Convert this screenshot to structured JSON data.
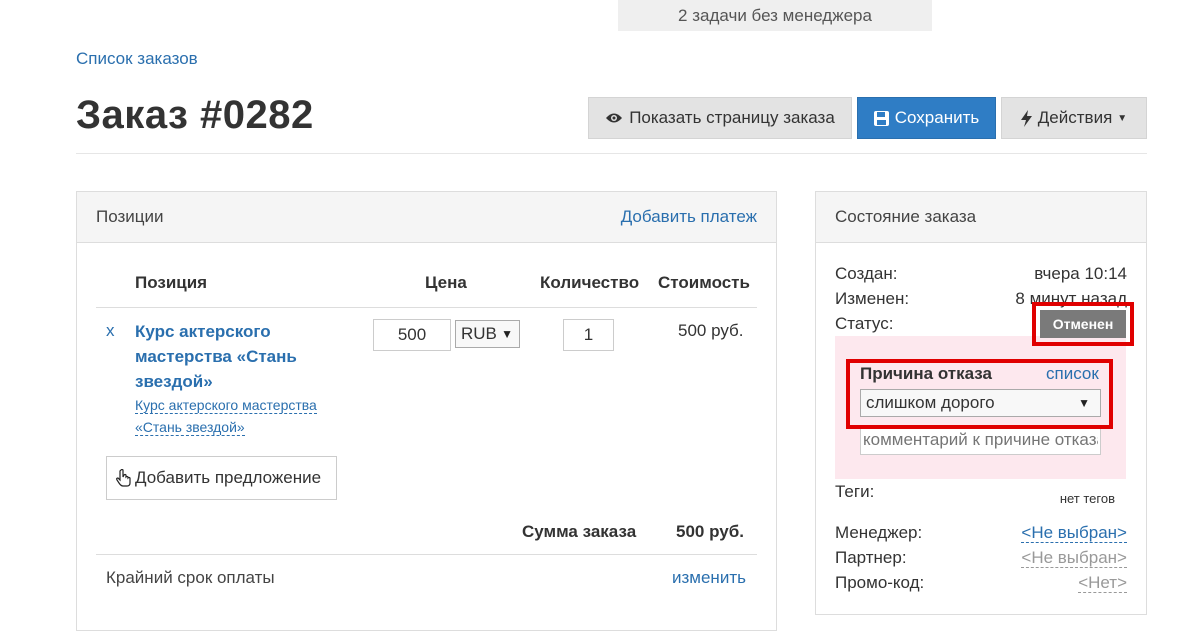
{
  "banner": {
    "text": "2 задачи без менеджера"
  },
  "breadcrumb": {
    "orders_list": "Список заказов"
  },
  "page": {
    "title": "Заказ #0282"
  },
  "toolbar": {
    "show_order_page": "Показать страницу заказа",
    "save": "Сохранить",
    "actions": "Действия"
  },
  "items_panel": {
    "title": "Позиции",
    "add_payment": "Добавить платеж",
    "columns": {
      "position": "Позиция",
      "price": "Цена",
      "quantity": "Количество",
      "cost": "Стоимость"
    },
    "item": {
      "remove": "x",
      "name_line1": "Курс актерского",
      "name_line2": "мастерства «Стань",
      "name_line3": "звездой»",
      "sub_line1": "Курс актерского мастерства",
      "sub_line2": "«Стань звездой»",
      "price": "500",
      "currency": "RUB",
      "quantity": "1",
      "cost": "500 руб."
    },
    "add_offer": "Добавить предложение",
    "total_label": "Сумма заказа",
    "total_value": "500 руб.",
    "deadline_label": "Крайний срок оплаты",
    "deadline_change": "изменить"
  },
  "status_panel": {
    "title": "Состояние заказа",
    "created_label": "Создан:",
    "created_value": "вчера 10:14",
    "modified_label": "Изменен:",
    "modified_value": "8 минут назад",
    "status_label": "Статус:",
    "status_value": "Отменен",
    "reason": {
      "label": "Причина отказа",
      "list_link": "список",
      "selected": "слишком дорого",
      "comment_placeholder": "комментарий к причине отказа"
    },
    "tags_label": "Теги:",
    "tags_value": "нет тегов",
    "manager_label": "Менеджер:",
    "manager_value": "<Не выбран>",
    "partner_label": "Партнер:",
    "partner_value": "<Не выбран>",
    "promo_label": "Промо-код:",
    "promo_value": "<Нет>"
  },
  "colors": {
    "primary": "#2f7dc5",
    "link": "#2a6fae",
    "status_badge": "#7a7a7a",
    "reason_background": "#fde8ee",
    "highlight": "#e00000"
  },
  "icons": {
    "show_order_page": "eye-icon",
    "save": "floppy-disk-icon",
    "actions": "lightning-icon",
    "add_offer": "hand-pointer-icon"
  }
}
